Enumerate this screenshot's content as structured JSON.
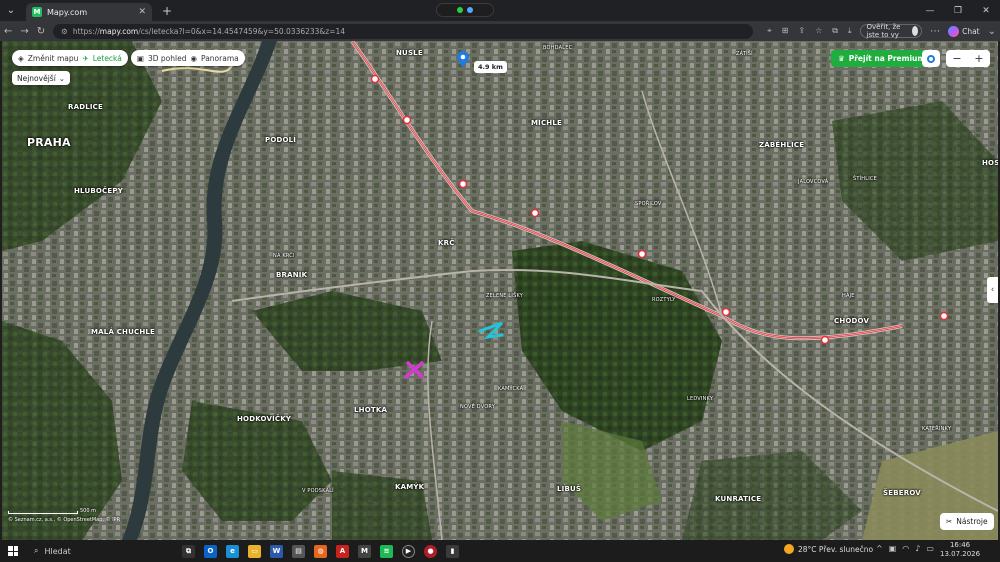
{
  "browser": {
    "tab_title": "Mapy.com",
    "tab_favicon": "M",
    "url_prefix": "https://",
    "url_host": "mapy.com",
    "url_path": "/cs/letecka?l=0&x=14.4547459&y=50.0336233&z=14",
    "profile_label": "Ověřit, že jste to vy",
    "chat_label": "Chat"
  },
  "map": {
    "toolbar": {
      "change_map": "Změnit mapu",
      "aerial": "Letecká",
      "view_3d": "3D pohled",
      "panorama": "Panorama"
    },
    "newest_label": "Nejnovější",
    "premium_button": "Přejít na Premium",
    "zoom_out": "−",
    "zoom_in": "+",
    "distance_label": "4.9 km",
    "tools_button": "Nástroje",
    "sidebar_toggle": "‹",
    "scale_text": "500 m",
    "attribution": "© Seznam.cz, a.s., © OpenStreetMap, © IPR",
    "places": [
      {
        "name": "PRAHA",
        "cls": "big"
      },
      {
        "name": "NUSLE",
        "cls": ""
      },
      {
        "name": "MICHLE",
        "cls": ""
      },
      {
        "name": "ZÁBĚHLICE",
        "cls": ""
      },
      {
        "name": "PODOLÍ",
        "cls": ""
      },
      {
        "name": "RADLICE",
        "cls": ""
      },
      {
        "name": "HLUBOČEPY",
        "cls": ""
      },
      {
        "name": "KRČ",
        "cls": ""
      },
      {
        "name": "BRANÍK",
        "cls": ""
      },
      {
        "name": "MALÁ CHUCHLE",
        "cls": ""
      },
      {
        "name": "CHODOV",
        "cls": ""
      },
      {
        "name": "HODKOVIČKY",
        "cls": ""
      },
      {
        "name": "LHOTKA",
        "cls": ""
      },
      {
        "name": "KAMÝK",
        "cls": ""
      },
      {
        "name": "LIBUŠ",
        "cls": ""
      },
      {
        "name": "KUNRATICE",
        "cls": ""
      },
      {
        "name": "ŠEBEROV",
        "cls": ""
      },
      {
        "name": "HOS",
        "cls": ""
      },
      {
        "name": "BOHDALEC",
        "cls": "small"
      },
      {
        "name": "ZELENÉ LIŠKY",
        "cls": "small"
      },
      {
        "name": "NA KRČI",
        "cls": "small"
      },
      {
        "name": "SPOŘILOV",
        "cls": "small"
      },
      {
        "name": "ROZTYLY",
        "cls": "small"
      },
      {
        "name": "HÁJE",
        "cls": "small"
      },
      {
        "name": "KATEŘINKY",
        "cls": "small"
      },
      {
        "name": "ZÁTIŠÍ",
        "cls": "small"
      },
      {
        "name": "JALOVCOVÁ",
        "cls": "small"
      },
      {
        "name": "ŠTÍHLICE",
        "cls": "small"
      },
      {
        "name": "LEDVINKY",
        "cls": "small"
      },
      {
        "name": "NOVÉ DVORY",
        "cls": "small"
      },
      {
        "name": "KAMÝCKÁ",
        "cls": "small"
      },
      {
        "name": "V PODSKALÍ",
        "cls": "small"
      }
    ]
  },
  "taskbar": {
    "search_label": "Hledat",
    "weather": "28°C  Přev. slunečno",
    "time": "16:46",
    "date": "13.07.2026"
  },
  "colors": {
    "brand_green": "#1fae3e",
    "route_red": "#e0303a",
    "marker_cyan": "#22c5d8",
    "marker_magenta": "#d43ad0"
  }
}
